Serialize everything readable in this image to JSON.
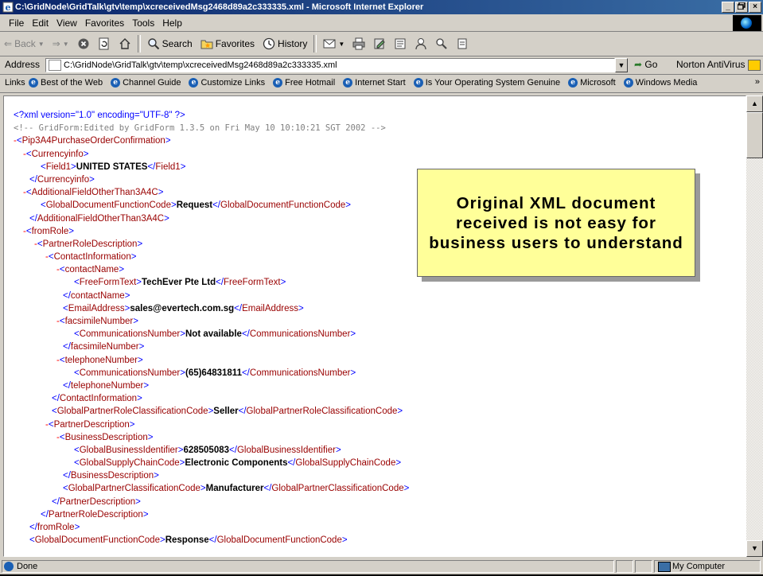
{
  "window": {
    "title": "C:\\GridNode\\GridTalk\\gtv\\temp\\xcreceivedMsg2468d89a2c333335.xml - Microsoft Internet Explorer",
    "controls": [
      "_",
      "×"
    ]
  },
  "menu": [
    "File",
    "Edit",
    "View",
    "Favorites",
    "Tools",
    "Help"
  ],
  "toolbar": {
    "back": "Back",
    "search": "Search",
    "favorites": "Favorites",
    "history": "History"
  },
  "address": {
    "label": "Address",
    "value": "C:\\GridNode\\GridTalk\\gtv\\temp\\xcreceivedMsg2468d89a2c333335.xml",
    "go": "Go",
    "norton": "Norton AntiVirus"
  },
  "links": {
    "label": "Links",
    "items": [
      "Best of the Web",
      "Channel Guide",
      "Customize Links",
      "Free Hotmail",
      "Internet Start",
      "Is Your Operating System Genuine",
      "Microsoft",
      "Windows Media"
    ]
  },
  "xml": {
    "declaration": "<?xml version=\"1.0\" encoding=\"UTF-8\" ?>",
    "comment": "<!-- GridForm:Edited by GridForm 1.3.5 on Fri May 10 10:10:21 SGT 2002 -->",
    "lines": [
      {
        "indent": 0,
        "minus": "-",
        "open": "Pip3A4PurchaseOrderConfirmation"
      },
      {
        "indent": 1,
        "minus": "-",
        "open": "Currencyinfo"
      },
      {
        "indent": 2,
        "open": "Field1",
        "text": "UNITED STATES",
        "close": "Field1"
      },
      {
        "indent": 1,
        "close": "Currencyinfo"
      },
      {
        "indent": 1,
        "minus": "-",
        "open": "AdditionalFieldOtherThan3A4C"
      },
      {
        "indent": 2,
        "open": "GlobalDocumentFunctionCode",
        "text": "Request",
        "close": "GlobalDocumentFunctionCode"
      },
      {
        "indent": 1,
        "close": "AdditionalFieldOtherThan3A4C"
      },
      {
        "indent": 1,
        "minus": "-",
        "open": "fromRole"
      },
      {
        "indent": 2,
        "minus": "-",
        "open": "PartnerRoleDescription"
      },
      {
        "indent": 3,
        "minus": "-",
        "open": "ContactInformation"
      },
      {
        "indent": 4,
        "minus": "-",
        "open": "contactName"
      },
      {
        "indent": 5,
        "open": "FreeFormText",
        "text": "TechEver Pte Ltd",
        "close": "FreeFormText"
      },
      {
        "indent": 4,
        "close": "contactName"
      },
      {
        "indent": 4,
        "open": "EmailAddress",
        "text": "sales@evertech.com.sg",
        "close": "EmailAddress"
      },
      {
        "indent": 4,
        "minus": "-",
        "open": "facsimileNumber"
      },
      {
        "indent": 5,
        "open": "CommunicationsNumber",
        "text": "Not available",
        "close": "CommunicationsNumber"
      },
      {
        "indent": 4,
        "close": "facsimileNumber"
      },
      {
        "indent": 4,
        "minus": "-",
        "open": "telephoneNumber"
      },
      {
        "indent": 5,
        "open": "CommunicationsNumber",
        "text": "(65)64831811",
        "close": "CommunicationsNumber"
      },
      {
        "indent": 4,
        "close": "telephoneNumber"
      },
      {
        "indent": 3,
        "close": "ContactInformation"
      },
      {
        "indent": 3,
        "open": "GlobalPartnerRoleClassificationCode",
        "text": "Seller",
        "close": "GlobalPartnerRoleClassificationCode"
      },
      {
        "indent": 3,
        "minus": "-",
        "open": "PartnerDescription"
      },
      {
        "indent": 4,
        "minus": "-",
        "open": "BusinessDescription"
      },
      {
        "indent": 5,
        "open": "GlobalBusinessIdentifier",
        "text": "628505083",
        "close": "GlobalBusinessIdentifier"
      },
      {
        "indent": 5,
        "open": "GlobalSupplyChainCode",
        "text": "Electronic Components",
        "close": "GlobalSupplyChainCode"
      },
      {
        "indent": 4,
        "close": "BusinessDescription"
      },
      {
        "indent": 4,
        "open": "GlobalPartnerClassificationCode",
        "text": "Manufacturer",
        "close": "GlobalPartnerClassificationCode"
      },
      {
        "indent": 3,
        "close": "PartnerDescription"
      },
      {
        "indent": 2,
        "close": "PartnerRoleDescription"
      },
      {
        "indent": 1,
        "close": "fromRole"
      },
      {
        "indent": 1,
        "open": "GlobalDocumentFunctionCode",
        "text": "Response",
        "close": "GlobalDocumentFunctionCode"
      }
    ]
  },
  "callout": {
    "text": "Original XML document received is not easy for business users to understand",
    "background": "#ffff99"
  },
  "status": {
    "text": "Done",
    "zone": "My Computer"
  },
  "colors": {
    "xml_tag": "#990000",
    "xml_bracket": "#0000ff",
    "xml_minus": "#ff0000",
    "title_bar_start": "#0a246a",
    "title_bar_end": "#3a6ea5"
  }
}
